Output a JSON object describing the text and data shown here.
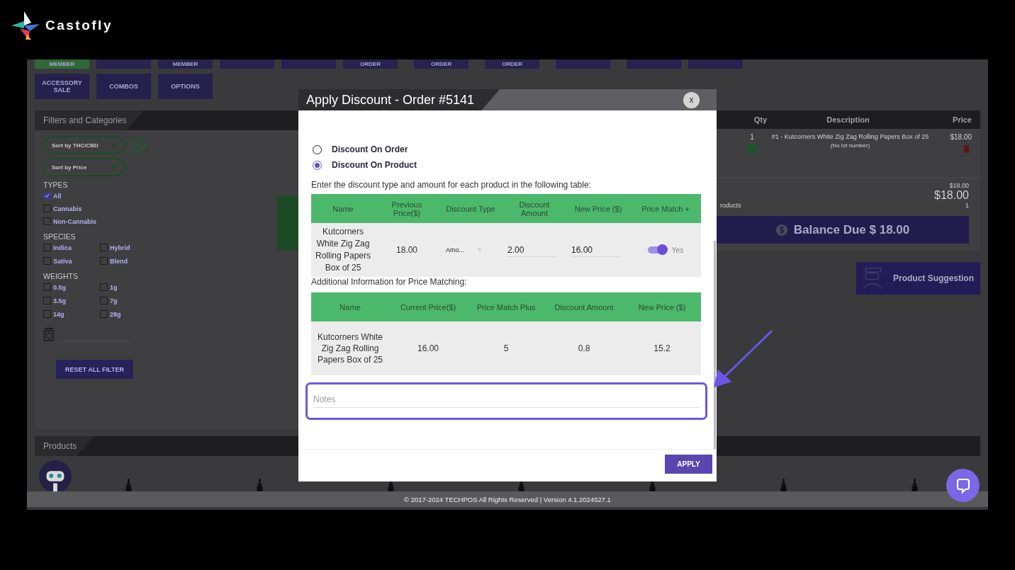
{
  "brand": {
    "name": "Castofly"
  },
  "top_buttons": [
    {
      "label": "MEMBER",
      "color": "#2f6a36"
    },
    {
      "color": "#27224f"
    },
    {
      "label": "MEMBER",
      "color": "#27224f"
    },
    {
      "color": "#27224f"
    },
    {
      "color": "#27224f"
    },
    {
      "label": "ORDER",
      "color": "#27224f"
    },
    {
      "label": "ORDER",
      "color": "#27224f"
    },
    {
      "label": "ORDER",
      "color": "#27224f"
    },
    {
      "color": "#27224f"
    },
    {
      "color": "#27224f"
    },
    {
      "color": "#27224f"
    }
  ],
  "menu_buttons": [
    "ACCESSORY SALE",
    "COMBOS",
    "OPTIONS"
  ],
  "filters": {
    "title": "Filters and Categories",
    "sorts": [
      "Sort by THC/CBD",
      "Sort by Price"
    ],
    "groups": [
      {
        "title": "TYPES",
        "kind": "list",
        "options": [
          {
            "label": "All",
            "checked": true
          },
          {
            "label": "Cannabis",
            "checked": false
          },
          {
            "label": "Non-Cannabis",
            "checked": false
          }
        ]
      },
      {
        "title": "SPECIES",
        "kind": "grid",
        "options": [
          {
            "label": "Indica",
            "checked": false
          },
          {
            "label": "Hybrid",
            "checked": false
          },
          {
            "label": "Sativa",
            "checked": false
          },
          {
            "label": "Blend",
            "checked": false
          }
        ]
      },
      {
        "title": "WEIGHTS",
        "kind": "grid",
        "options": [
          {
            "label": "0.5g",
            "checked": false
          },
          {
            "label": "1g",
            "checked": false
          },
          {
            "label": "3.5g",
            "checked": false
          },
          {
            "label": "7g",
            "checked": false
          },
          {
            "label": "14g",
            "checked": false
          },
          {
            "label": "28g",
            "checked": false
          }
        ]
      }
    ],
    "reset": "RESET ALL FILTER"
  },
  "cart": {
    "columns": [
      "Qty",
      "Description",
      "Price"
    ],
    "items": [
      {
        "qty": "1",
        "description": "#1 - Kutcorners White Zig Zag Rolling Papers Box of 25",
        "lot": "(No lot number)",
        "price": "$18.00"
      }
    ],
    "subtotal": "$18.00",
    "total": "$18.00",
    "products_label": "roducts",
    "product_count": "1",
    "balance": "Balance Due $ 18.00"
  },
  "product_suggestion": "Product Suggestion",
  "products": {
    "title": "Products"
  },
  "footer": "© 2017-2024 TECHPOS All Rights Reserved | Version 4.1.2024527.1",
  "modal": {
    "title": "Apply Discount - Order #5141",
    "close": "x",
    "options": [
      {
        "label": "Discount On Order",
        "selected": false
      },
      {
        "label": "Discount On Product",
        "selected": true
      }
    ],
    "instruction": "Enter the discount type and amount for each product in the following table:",
    "discount_table": {
      "columns": [
        "Name",
        "Previous Price($)",
        "Discount Type",
        "Discount Amount",
        "New Price ($)",
        "Price Match +"
      ],
      "rows": [
        {
          "name": "Kutcorners White Zig Zag Rolling Papers Box of 25",
          "previous_price": "18.00",
          "discount_type": "Amo...",
          "discount_amount": "2.00",
          "new_price": "16.00",
          "price_match": {
            "on": true,
            "label": "Yes"
          }
        }
      ]
    },
    "price_match_title": "Additional Information for Price Matching:",
    "price_match_table": {
      "columns": [
        "Name",
        "Current Price($)",
        "Price Match Plus",
        "Discount Amount",
        "New Price ($)"
      ],
      "rows": [
        [
          "Kutcorners White Zig Zag Rolling Papers Box of 25",
          "16.00",
          "5",
          "0.8",
          "15.2"
        ]
      ]
    },
    "notes": {
      "placeholder": "Notes"
    },
    "apply": "APPLY"
  }
}
